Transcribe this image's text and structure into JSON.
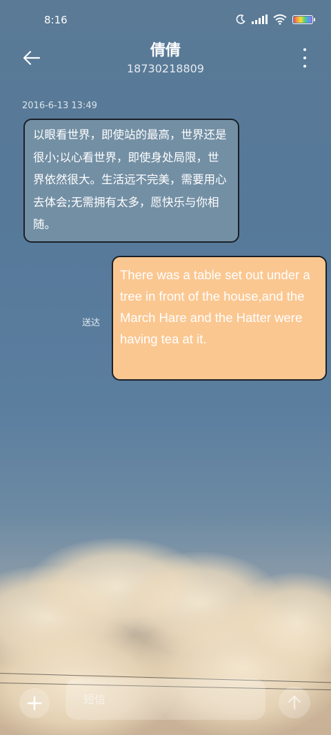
{
  "status_bar": {
    "time": "8:16",
    "icons": [
      "moon-icon",
      "signal-icon",
      "wifi-icon",
      "battery-icon"
    ]
  },
  "header": {
    "contact_name": "倩倩",
    "contact_number": "18730218809",
    "back_icon": "back-arrow-icon",
    "more_icon": "more-vertical-icon"
  },
  "conversation": {
    "timestamp": "2016-6-13 13:49",
    "messages": [
      {
        "direction": "incoming",
        "text": "以眼看世界，即使站的最高，世界还是很小;以心看世界，即使身处局限，世界依然很大。生活远不完美，需要用心去体会;无需拥有太多，愿快乐与你相随。"
      },
      {
        "direction": "outgoing",
        "text": "There was a table set out under a tree in front of the house,and the March Hare and the Hatter were having tea at it.",
        "status": "送达"
      }
    ]
  },
  "composer": {
    "placeholder": "短信",
    "add_icon": "plus-icon",
    "send_icon": "send-arrow-icon"
  },
  "colors": {
    "incoming_bubble": "#738fa4",
    "outgoing_bubble": "#fbc791",
    "bubble_border": "#1a1f26"
  }
}
